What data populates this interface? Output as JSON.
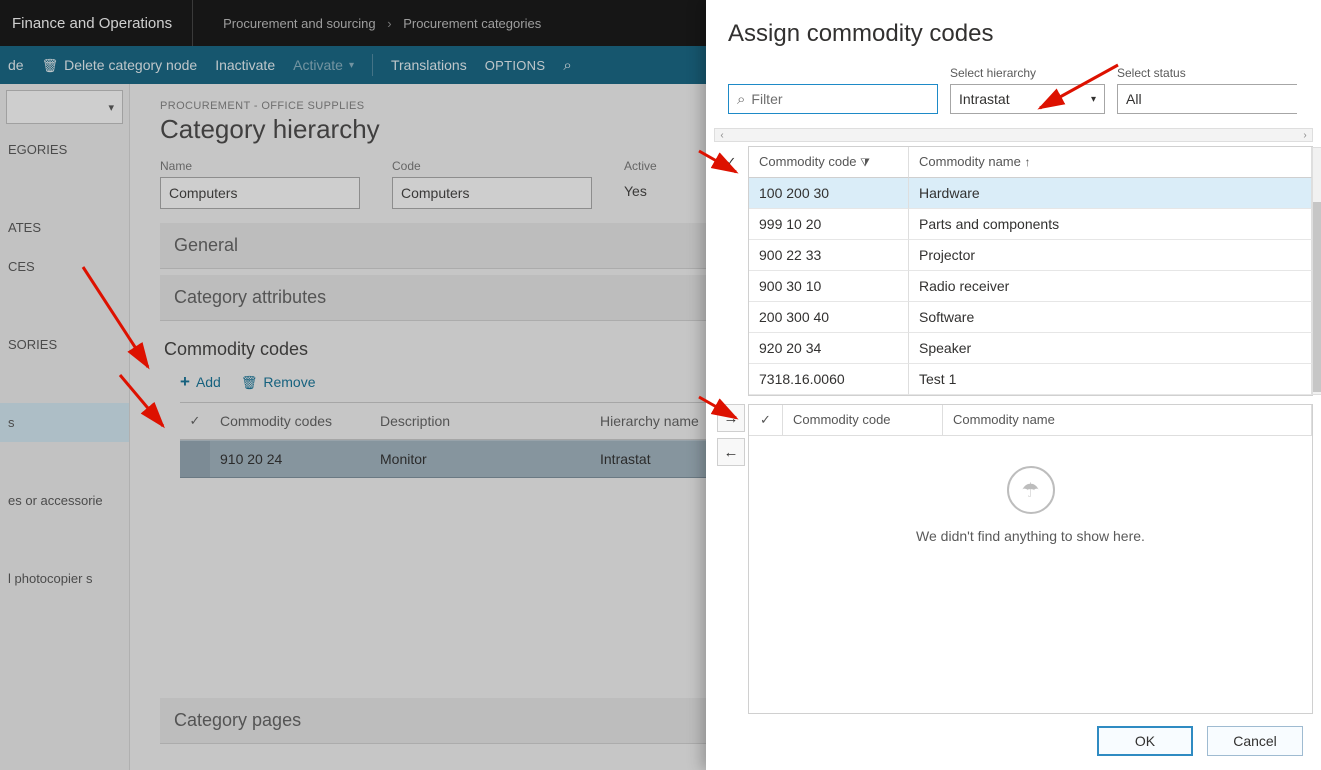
{
  "app": {
    "title": "Finance and Operations",
    "breadcrumb": [
      "Procurement and sourcing",
      "Procurement categories"
    ]
  },
  "action_bar": {
    "node_suffix": "de",
    "delete": "Delete category node",
    "inactivate": "Inactivate",
    "activate": "Activate",
    "translations": "Translations",
    "options": "OPTIONS"
  },
  "sidebar": {
    "items": [
      "EGORIES",
      "",
      "ATES",
      "CES",
      "",
      "SORIES",
      "",
      "s",
      "",
      "es or accessorie",
      "",
      "l photocopier s"
    ],
    "selected_index": 7
  },
  "page": {
    "crumb_small": "PROCUREMENT - OFFICE SUPPLIES",
    "title": "Category hierarchy",
    "fields": {
      "name": {
        "label": "Name",
        "value": "Computers"
      },
      "code": {
        "label": "Code",
        "value": "Computers"
      },
      "active": {
        "label": "Active",
        "value": "Yes"
      }
    },
    "collapses": [
      "General",
      "Category attributes"
    ],
    "last_collapse": "Category pages",
    "commodity": {
      "title": "Commodity codes",
      "add": "Add",
      "remove": "Remove",
      "columns": {
        "code": "Commodity codes",
        "desc": "Description",
        "hier": "Hierarchy name"
      },
      "rows": [
        {
          "code": "910 20 24",
          "desc": "Monitor",
          "hier": "Intrastat"
        }
      ]
    }
  },
  "panel": {
    "title": "Assign commodity codes",
    "filter_placeholder": "Filter",
    "select_hierarchy": {
      "label": "Select hierarchy",
      "value": "Intrastat"
    },
    "select_status": {
      "label": "Select status",
      "value": "All"
    },
    "columns": {
      "code": "Commodity code",
      "name": "Commodity name"
    },
    "rows": [
      {
        "code": "100 200 30",
        "name": "Hardware",
        "selected": true
      },
      {
        "code": "999 10 20",
        "name": "Parts and components"
      },
      {
        "code": "900 22 33",
        "name": "Projector"
      },
      {
        "code": "900 30 10",
        "name": "Radio receiver"
      },
      {
        "code": "200 300 40",
        "name": "Software"
      },
      {
        "code": "920 20 34",
        "name": "Speaker"
      },
      {
        "code": "7318.16.0060",
        "name": "Test 1"
      }
    ],
    "target_columns": {
      "code": "Commodity code",
      "name": "Commodity name"
    },
    "empty_text": "We didn't find anything to show here.",
    "ok": "OK",
    "cancel": "Cancel"
  }
}
